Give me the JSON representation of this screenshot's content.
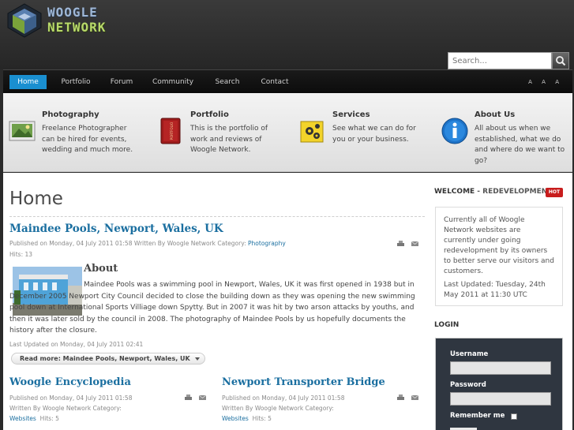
{
  "header": {
    "logo_line1": "WOOGLE",
    "logo_line2": "NETWORK",
    "search_placeholder": "Search..."
  },
  "nav": {
    "items": [
      {
        "label": "Home",
        "active": true
      },
      {
        "label": "Portfolio"
      },
      {
        "label": "Forum"
      },
      {
        "label": "Community"
      },
      {
        "label": "Search"
      },
      {
        "label": "Contact"
      }
    ],
    "text_size_tools": "A A A"
  },
  "features": [
    {
      "title": "Photography",
      "text": "Freelance Photographer can be hired for events, wedding and much more.",
      "icon": "photo-album-icon"
    },
    {
      "title": "Portfolio",
      "text": "This is the portfolio of work and reviews of Woogle Network.",
      "icon": "portfolio-book-icon"
    },
    {
      "title": "Services",
      "text": "See what we can do for you or your business.",
      "icon": "services-gears-icon"
    },
    {
      "title": "About Us",
      "text": "All about us when we established, what we do and where do we want to go?",
      "icon": "info-icon"
    }
  ],
  "main": {
    "page_title": "Home",
    "lead_article": {
      "title": "Maindee Pools, Newport, Wales, UK",
      "meta": "Published on Monday, 04 July 2011 01:58   Written By Woogle Network   Category: ",
      "category": "Photography",
      "hits": "Hits: 13",
      "about_heading": "About",
      "body_first": "Maindee Pools was a swimming pool in Newport, Wales, UK it was first opened in 1938 but in December 2005 Newport City Council decided to close the building down as they was opening the new swimming pool down at International Sports Villiage down Spytty. But in 2007 it was hit by two arson attacks by youths, and then it was later sold by the council in 2008. The photography of Maindee Pools by us hopefully documents the history after the closure.",
      "last_updated": "Last Updated on Monday, 04 July 2011 02:41",
      "read_more": "Read more: Maindee Pools, Newport, Wales, UK"
    },
    "articles": [
      {
        "title": "Woogle Encyclopedia",
        "meta1": "Published on Monday, 04 July 2011 01:58",
        "meta2": "Written By Woogle Network   Category:",
        "category": "Websites",
        "hits": "Hits: 5"
      },
      {
        "title": "Newport Transporter Bridge",
        "meta1": "Published on Monday, 04 July 2011 01:58",
        "meta2": "Written By Woogle Network   Category:",
        "category": "Websites",
        "hits": "Hits: 5"
      }
    ]
  },
  "sidebar": {
    "welcome_title": "WELCOME",
    "welcome_sub": " - REDEVELOPMENT",
    "hot_badge": "HOT",
    "welcome_text": "Currently all of Woogle Network websites are currently under going redevelopment by its owners to better serve our visitors and customers.",
    "welcome_updated": "Last Updated: Tuesday, 24th May 2011 at 11:30 UTC",
    "login_title": "LOGIN",
    "username_label": "Username",
    "password_label": "Password",
    "remember_label": "Remember me"
  },
  "colors": {
    "accent": "#1a8fd0",
    "link": "#1b6fa0",
    "hot": "#c81d1d"
  }
}
